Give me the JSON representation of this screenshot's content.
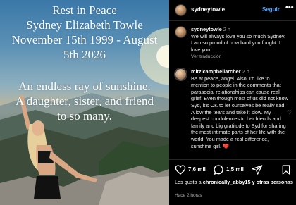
{
  "photo": {
    "title_lines": [
      "Rest in Peace",
      "Sydney Elizabeth Towle",
      "November 15th 1999 - August",
      "5th 2026"
    ],
    "body_lines": [
      "An endless ray of sunshine.",
      "A daughter, sister, and friend",
      "to so many."
    ]
  },
  "header": {
    "username": "sydneytowle",
    "follow_label": "Seguir",
    "more_label": "•••"
  },
  "comments": [
    {
      "username": "sydneytowle",
      "time": "2 h",
      "text": "We will always love you so much Sydney. I am so proud of how hard you fought. I love you.",
      "translate": "Ver traducción"
    },
    {
      "username": "mitzicampbellarcher",
      "time": "2 h",
      "text": "Be at peace, angel. Also, I’d like to mention to people in the comments that parasocial relationships can cause real grief. Even though most of us did not know Syd, it’s OK to let ourselves be really sad. Allow the tears and take it slow. My deepest condolences to her friends and family and big gratitude to Syd for sharing the most intimate parts of her life with the world. You made a real difference, sunshine girl. ❤️"
    }
  ],
  "actions": {
    "likes_count": "7,6 mil",
    "comments_count": "1,5 mil"
  },
  "likes_line": {
    "prefix": "Les gusta a ",
    "user": "chronically_abby15",
    "suffix": " y otras personas"
  },
  "timestamp": "Hace 2 horas",
  "colors": {
    "accent": "#4aa3ff",
    "background": "#000000",
    "heart": "#ed4956"
  }
}
